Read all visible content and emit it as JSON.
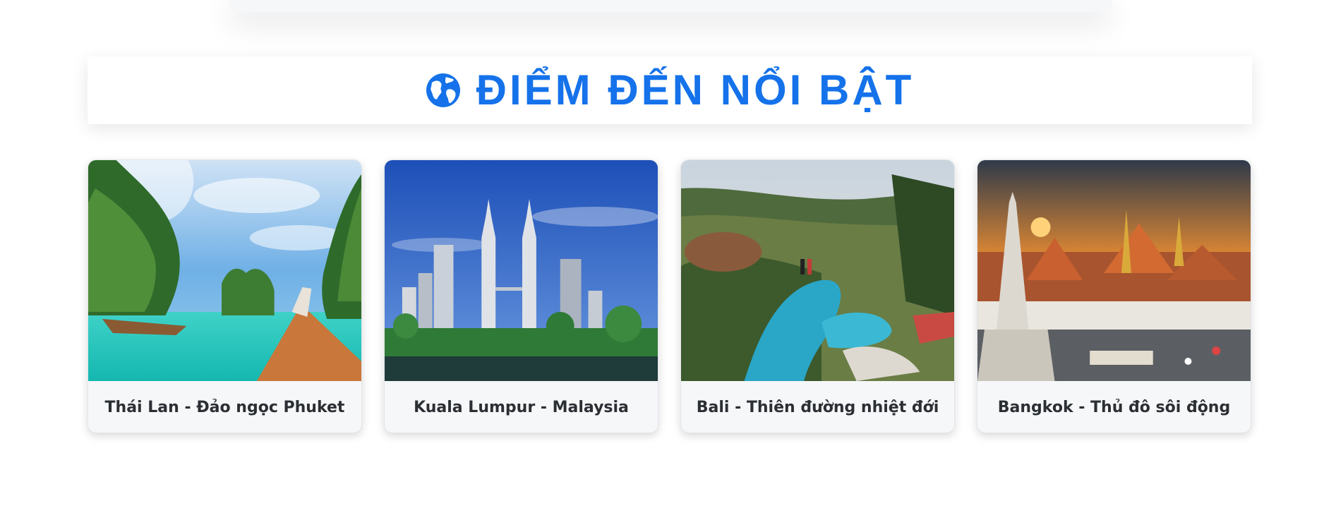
{
  "header": {
    "title": "ĐIỂM ĐẾN NỔI BẬT",
    "icon": "globe-icon",
    "accent_color": "#1572ea"
  },
  "destinations": [
    {
      "caption": "Thái Lan - Đảo ngọc Phuket",
      "image": "thailand-phuket-beach-photo"
    },
    {
      "caption": "Kuala Lumpur - Malaysia",
      "image": "kuala-lumpur-petronas-towers-photo"
    },
    {
      "caption": "Bali - Thiên đường nhiệt đới",
      "image": "bali-jungle-pool-photo"
    },
    {
      "caption": "Bangkok - Thủ đô sôi động",
      "image": "bangkok-grand-palace-photo"
    }
  ]
}
